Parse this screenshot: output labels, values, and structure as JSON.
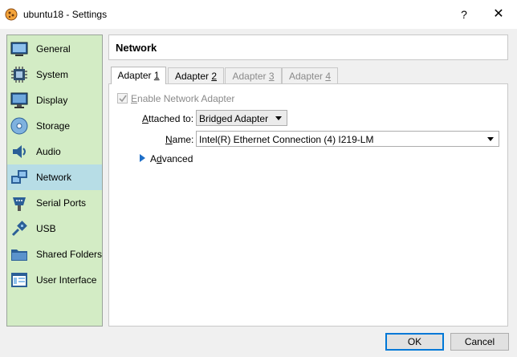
{
  "window": {
    "title": "ubuntu18 - Settings",
    "help_label": "?",
    "close_label": "✕"
  },
  "sidebar": {
    "items": [
      {
        "label": "General",
        "icon": "general-icon"
      },
      {
        "label": "System",
        "icon": "system-chip-icon"
      },
      {
        "label": "Display",
        "icon": "display-monitor-icon"
      },
      {
        "label": "Storage",
        "icon": "storage-disc-icon"
      },
      {
        "label": "Audio",
        "icon": "audio-speaker-icon"
      },
      {
        "label": "Network",
        "icon": "network-icon",
        "active": true
      },
      {
        "label": "Serial Ports",
        "icon": "serial-port-icon"
      },
      {
        "label": "USB",
        "icon": "usb-icon"
      },
      {
        "label": "Shared Folders",
        "icon": "folder-icon"
      },
      {
        "label": "User Interface",
        "icon": "user-interface-icon"
      }
    ]
  },
  "header": {
    "title": "Network"
  },
  "tabs": [
    {
      "prefix": "Adapter ",
      "num": "1",
      "state": "active"
    },
    {
      "prefix": "Adapter ",
      "num": "2",
      "state": "enabled"
    },
    {
      "prefix": "Adapter ",
      "num": "3",
      "state": "disabled"
    },
    {
      "prefix": "Adapter ",
      "num": "4",
      "state": "disabled"
    }
  ],
  "adapter": {
    "enable_prefix": "",
    "enable_accel": "E",
    "enable_rest": "nable Network Adapter",
    "enable_checked": true,
    "attached_accel": "A",
    "attached_rest": "ttached to:",
    "attached_value": "Bridged Adapter",
    "name_accel": "N",
    "name_rest": "ame:",
    "name_value": "Intel(R) Ethernet Connection (4) I219-LM",
    "advanced_accel": "d",
    "advanced_pre": "A",
    "advanced_rest": "vanced"
  },
  "buttons": {
    "ok": "OK",
    "cancel": "Cancel"
  }
}
